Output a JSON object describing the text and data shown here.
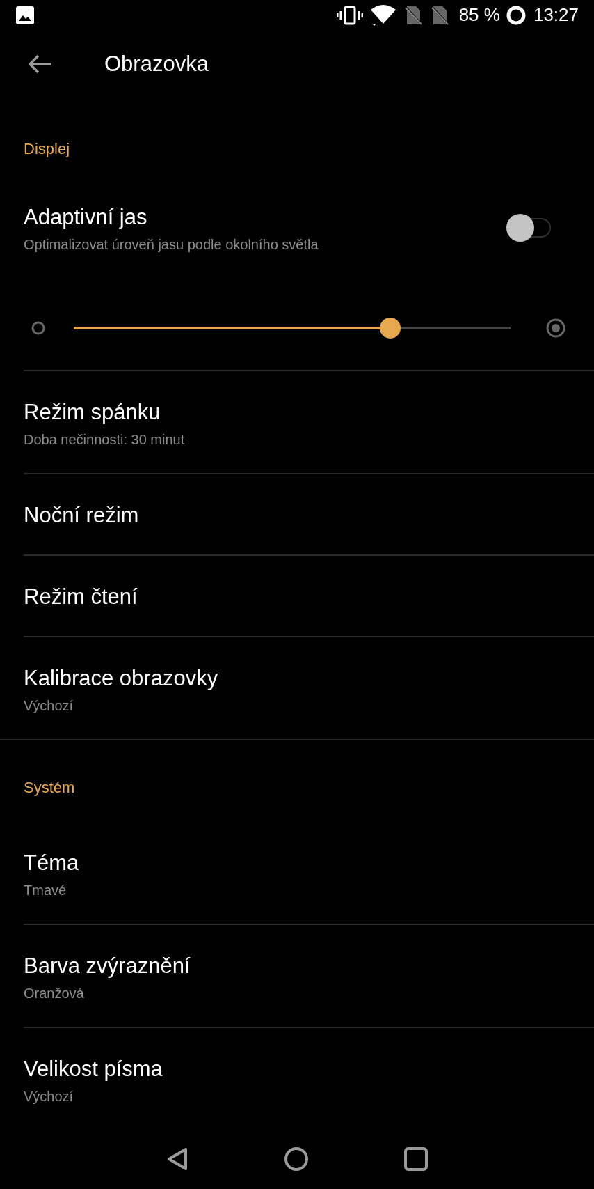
{
  "status_bar": {
    "battery": "85 %",
    "time": "13:27"
  },
  "toolbar": {
    "title": "Obrazovka"
  },
  "sections": [
    {
      "title": "Displej",
      "items": [
        {
          "kind": "toggle",
          "title": "Adaptivní jas",
          "subtitle": "Optimalizovat úroveň jasu podle okolního světla",
          "on": false
        },
        {
          "kind": "slider",
          "level": 0.725
        },
        {
          "kind": "item",
          "title": "Režim spánku",
          "subtitle": "Doba nečinnosti: 30 minut"
        },
        {
          "kind": "item",
          "title": "Noční režim"
        },
        {
          "kind": "item",
          "title": "Režim čtení"
        },
        {
          "kind": "item",
          "title": "Kalibrace obrazovky",
          "subtitle": "Výchozí"
        }
      ]
    },
    {
      "title": "Systém",
      "items": [
        {
          "kind": "item",
          "title": "Téma",
          "subtitle": "Tmavé"
        },
        {
          "kind": "item",
          "title": "Barva zvýraznění",
          "subtitle": "Oranžová"
        },
        {
          "kind": "item",
          "title": "Velikost písma",
          "subtitle": "Výchozí"
        }
      ]
    }
  ]
}
